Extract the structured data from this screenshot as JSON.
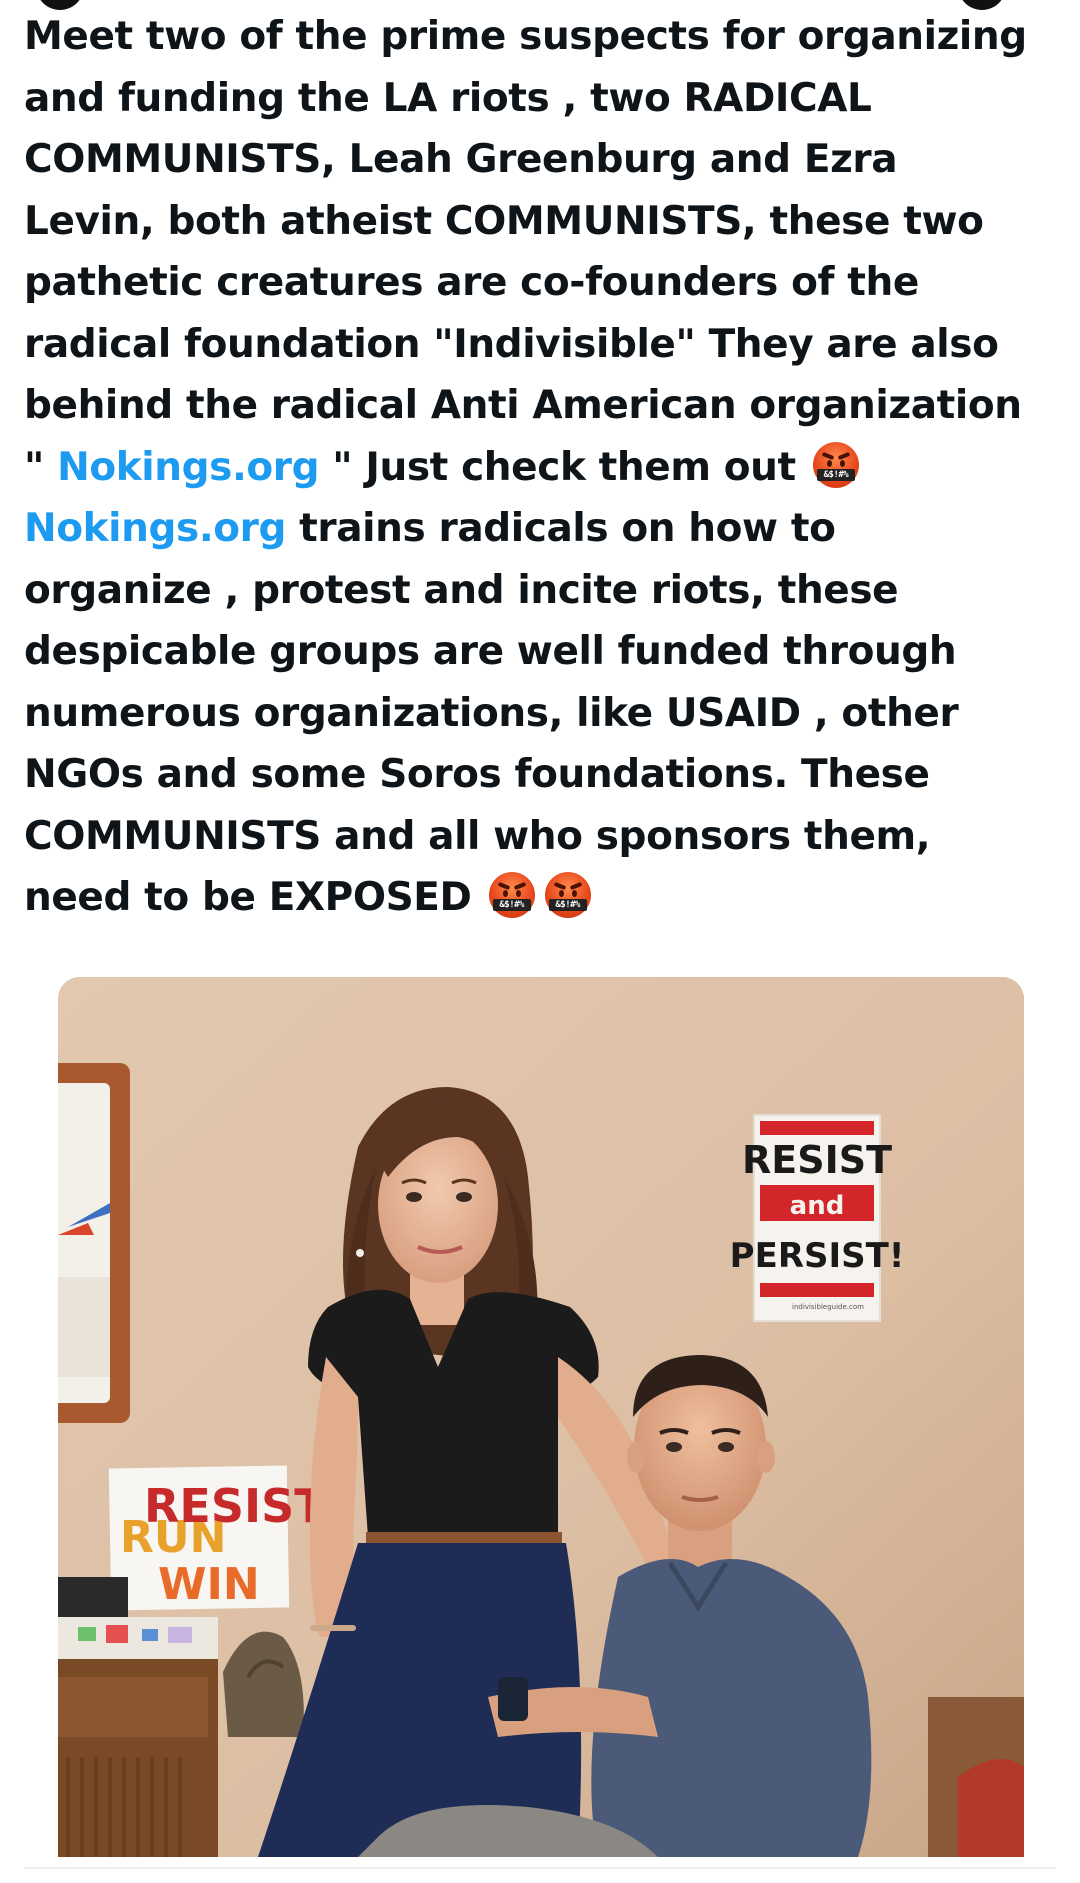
{
  "post": {
    "lines": [
      {
        "parts": [
          {
            "text": "Meet two of the prime suspects for organizing"
          }
        ]
      },
      {
        "parts": [
          {
            "text": "and funding the LA riots , two RADICAL"
          }
        ]
      },
      {
        "parts": [
          {
            "text": "COMMUNISTS,  Leah Greenburg and Ezra"
          }
        ]
      },
      {
        "parts": [
          {
            "text": "Levin,  both atheist COMMUNISTS, these two"
          }
        ]
      },
      {
        "parts": [
          {
            "text": "pathetic creatures are co-founders of the"
          }
        ]
      },
      {
        "parts": [
          {
            "text": "radical foundation \"Indivisible\" They are also"
          }
        ]
      },
      {
        "parts": [
          {
            "text": "behind the radical Anti American organization"
          }
        ]
      },
      {
        "parts": [
          {
            "text": "\" "
          },
          {
            "text": "Nokings.org",
            "link": true
          },
          {
            "text": " \"  Just check them out "
          }
        ],
        "emoji_count": 1
      },
      {
        "parts": [
          {
            "text": "Nokings.org",
            "link": true
          },
          {
            "text": "  trains radicals on how to"
          }
        ]
      },
      {
        "parts": [
          {
            "text": "organize , protest and incite riots, these"
          }
        ]
      },
      {
        "parts": [
          {
            "text": "despicable groups are well funded through"
          }
        ]
      },
      {
        "parts": [
          {
            "text": "numerous organizations,  like USAID , other"
          }
        ]
      },
      {
        "parts": [
          {
            "text": "NGOs and some Soros foundations. These"
          }
        ]
      },
      {
        "parts": [
          {
            "text": "COMMUNISTS and all who sponsors them,"
          }
        ]
      },
      {
        "parts": [
          {
            "text": "need to be EXPOSED "
          }
        ],
        "emoji_count": 2
      }
    ],
    "emoji": {
      "name": "face-with-symbols-on-mouth-icon",
      "symbols": "&$!#%",
      "color": "#e8481d"
    },
    "link_color": "#1d9bf0",
    "text_color": "#0f1419"
  },
  "photo": {
    "poster_right": {
      "line1": "RESIST",
      "line2": "and",
      "line3": "PERSIST!",
      "footer": "indivisibleguide.com"
    },
    "poster_left": {
      "line1": "RESIST",
      "line2": "RUN",
      "line3": "WIN"
    },
    "colors": {
      "wall": "#dcc1a8",
      "poster_red": "#d2262a"
    }
  }
}
